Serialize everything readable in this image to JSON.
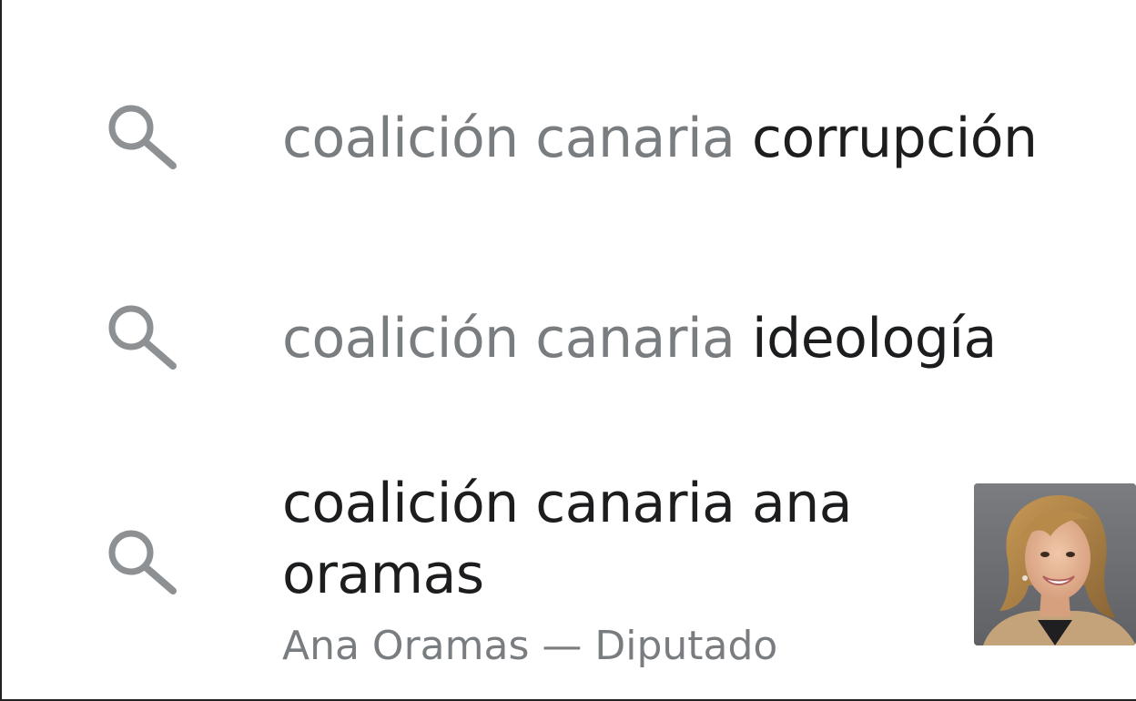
{
  "suggestions": [
    {
      "typed": "coalición canaria",
      "completion": "corrupción",
      "icon": "search-icon"
    },
    {
      "typed": "coalición canaria",
      "completion": "ideología",
      "icon": "search-icon"
    },
    {
      "line1": "coalición canaria ana",
      "line2": "oramas",
      "subtitle": "Ana Oramas — Diputado",
      "icon": "search-icon",
      "thumbnail": "person-photo"
    }
  ],
  "colors": {
    "typed_text": "#7a7d80",
    "completion_text": "#1c1d1f",
    "icon": "#8e9194",
    "background": "#ffffff"
  }
}
